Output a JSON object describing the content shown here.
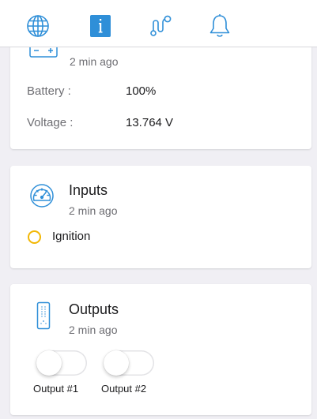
{
  "colors": {
    "accent": "#2f8fd8",
    "ignition_off": "#f2b705",
    "background": "#f0eff4"
  },
  "tabs": [
    {
      "icon": "globe-icon",
      "active": false
    },
    {
      "icon": "info-icon",
      "active": true
    },
    {
      "icon": "route-icon",
      "active": false
    },
    {
      "icon": "bell-icon",
      "active": false
    }
  ],
  "power": {
    "icon": "battery-icon",
    "updated": "2 min ago",
    "battery_label": "Battery :",
    "battery_value": "100%",
    "voltage_label": "Voltage :",
    "voltage_value": "13.764 V"
  },
  "inputs": {
    "icon": "gauge-icon",
    "title": "Inputs",
    "updated": "2 min ago",
    "items": [
      {
        "label": "Ignition",
        "state": "off"
      }
    ]
  },
  "outputs": {
    "icon": "remote-icon",
    "title": "Outputs",
    "updated": "2 min ago",
    "items": [
      {
        "label": "Output #1",
        "on": false
      },
      {
        "label": "Output #2",
        "on": false
      }
    ]
  }
}
